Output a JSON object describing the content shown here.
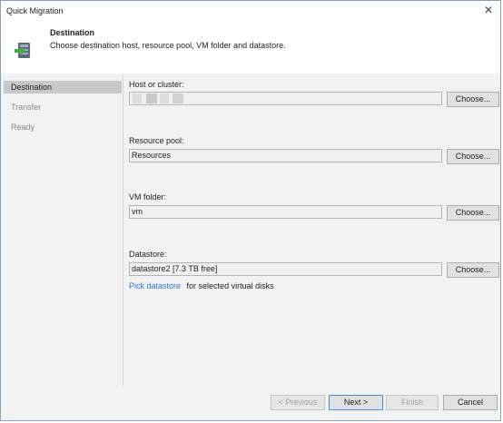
{
  "window": {
    "title": "Quick Migration",
    "close_glyph": "✕"
  },
  "header": {
    "title": "Destination",
    "subtitle": "Choose destination host, resource pool, VM folder and datastore.",
    "icon": "migration-wizard-icon"
  },
  "steps": [
    {
      "label": "Destination",
      "active": true
    },
    {
      "label": "Transfer",
      "active": false
    },
    {
      "label": "Ready",
      "active": false
    }
  ],
  "fields": {
    "host": {
      "label": "Host or cluster:",
      "value": "",
      "button": "Choose..."
    },
    "pool": {
      "label": "Resource pool:",
      "value": "Resources",
      "button": "Choose..."
    },
    "folder": {
      "label": "VM folder:",
      "value": "vm",
      "button": "Choose..."
    },
    "datastore": {
      "label": "Datastore:",
      "value": "datastore2 [7.3 TB free]",
      "button": "Choose..."
    }
  },
  "pick": {
    "link": "Pick datastore",
    "text": "for selected virtual disks"
  },
  "footer": {
    "previous": "< Previous",
    "next": "Next >",
    "finish": "Finish",
    "cancel": "Cancel"
  },
  "colors": {
    "link": "#2a76d2",
    "active_step": "#c8c8c8",
    "panel_bg": "#f2f2f2",
    "primary_border": "#3a8fe0"
  }
}
